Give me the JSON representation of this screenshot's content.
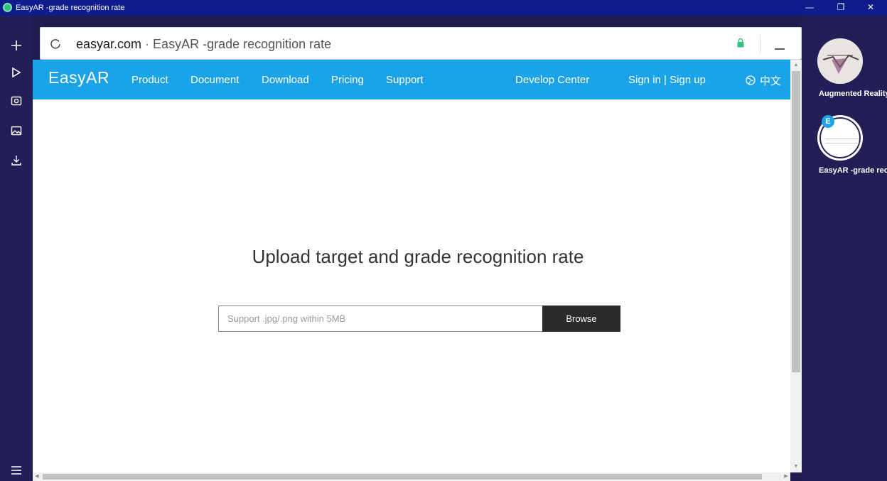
{
  "window": {
    "title": "EasyAR -grade recognition rate",
    "controls": {
      "minimize": "—",
      "restore": "❐",
      "close": "✕"
    }
  },
  "left_rail": {
    "items": [
      {
        "icon": "plus-icon"
      },
      {
        "icon": "play-icon"
      },
      {
        "icon": "camera-icon"
      },
      {
        "icon": "image-icon"
      },
      {
        "icon": "download-icon"
      },
      {
        "icon": "menu-icon"
      }
    ]
  },
  "address_bar": {
    "domain": "easyar.com",
    "separator": " · ",
    "page_title": "EasyAR -grade recognition rate",
    "secure_color": "#2ec27e"
  },
  "site": {
    "brand_color": "#1ba3e8",
    "logo": "EasyAR",
    "nav": {
      "product": "Product",
      "document": "Document",
      "download": "Download",
      "pricing": "Pricing",
      "support": "Support",
      "develop_center": "Develop Center",
      "sign_in": "Sign in | Sign up",
      "language": "中文"
    },
    "headline": "Upload target and grade recognition rate",
    "upload": {
      "placeholder": "Support .jpg/.png within 5MB",
      "browse_label": "Browse"
    }
  },
  "tabs_panel": {
    "tabs": [
      {
        "label": "Augmented Reality"
      },
      {
        "label": "EasyAR -grade recognition rate",
        "badge": "E"
      }
    ]
  }
}
